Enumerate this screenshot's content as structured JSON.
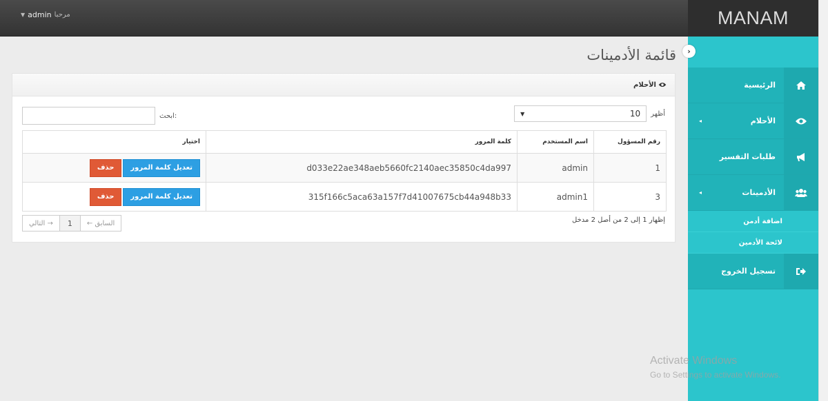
{
  "header": {
    "welcome": "مرحبا",
    "username": "admin"
  },
  "sidebar": {
    "brand": "MANAM",
    "items": [
      {
        "label": "الرئيسية",
        "icon": "home-icon"
      },
      {
        "label": "الأحلام",
        "icon": "eye-icon"
      },
      {
        "label": "طلبات التفسير",
        "icon": "megaphone-icon"
      },
      {
        "label": "الأدمينات",
        "icon": "users-icon"
      },
      {
        "label": "تسجيل الخروج",
        "icon": "logout-icon"
      }
    ],
    "submenu": [
      {
        "label": "اضافة أدمن"
      },
      {
        "label": "لائحة الأدمين"
      }
    ]
  },
  "main": {
    "page_title": "قائمة الأدمينات",
    "panel_title": "الأحلام",
    "show_label": "أظهر",
    "show_value": "10",
    "search_label": "ابحث:",
    "columns": [
      "رقم المسؤول",
      "اسم المستخدم",
      "كلمة المرور",
      "اختيار"
    ],
    "rows": [
      {
        "id": "1",
        "username": "admin",
        "password": "d033e22ae348aeb5660fc2140aec35850c4da997"
      },
      {
        "id": "3",
        "username": "admin1",
        "password": "315f166c5aca63a157f7d41007675cb44a948b33"
      }
    ],
    "btn_change": "تعديل كلمة المرور",
    "btn_delete": "حذف",
    "info": "إظهار 1 إلى 2 من أصل 2 مدخل",
    "pager": {
      "prev": "← السابق",
      "page": "1",
      "next": "التالي →"
    }
  },
  "watermark": {
    "line1": "Activate Windows",
    "line2": "Go to Settings to activate Windows."
  }
}
